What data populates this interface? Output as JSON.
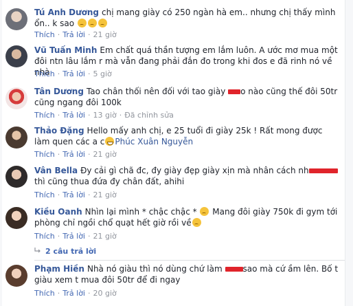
{
  "comments": [
    {
      "name": "Tú Anh Dương",
      "pre": "chị mang giày có 250 ngàn hà em.. nhưng chị thấy mình ổn.. k sao",
      "post": "",
      "act1": "Thích",
      "act2": "Trả lời",
      "time": "21 giờ"
    },
    {
      "name": "Vũ Tuấn Minh",
      "pre": "Em chất quá thần tượng em lắm luôn. A ước mơ mua một đôi ntn lâu lắm r mà vẫn đang phải đắn đo trong khi đos e đã rinh nó về nhà",
      "post": "",
      "act1": "Thích",
      "act2": "Trả lời",
      "time": "5 giờ"
    },
    {
      "name": "Tân Dương",
      "pre": "Tao chân thối nên đối với tao giày ",
      "post": "o nào cũng thế đôi 50tr cũng ngang đôi 100k",
      "act1": "Thích",
      "act2": "Trả lời",
      "time": "13 giờ",
      "edited": "Đã chỉnh sửa"
    },
    {
      "name": "Thảo Đặng",
      "pre": "Hello mấy anh chị, e 25 tuổi đi giày 25k ! Rất mong được làm quen các a c",
      "post": "",
      "tag": "Phúc Xuân Nguyễn",
      "act1": "Thích",
      "act2": "Trả lời",
      "time": "21 giờ"
    },
    {
      "name": "Vân Bella",
      "pre": "Đy cải gì chã đc, đy giày đẹp giày xịn mà nhân cách nh",
      "post": "thì cũng thua đứa đy chân đất, ahihi",
      "act1": "Thích",
      "act2": "Trả lời",
      "time": "21 giờ"
    },
    {
      "name": "Kiều Oanh",
      "pre": "Nhìn lại mình * chậc chậc * ",
      "post": "Mang đôi giày 750k đi gym tới phòng chỉ ngồi chổ quạt hết giờ rồi về",
      "act1": "Thích",
      "act2": "Trả lời",
      "time": "21 giờ",
      "replies": "2 câu trả lời"
    },
    {
      "name": "Phạm Hiền",
      "pre": "Nhà nó giàu thì nó dùng chứ làm ",
      "post": "sao mà cứ ầm lên. Bố t giàu xem t mua đôi 50tr để đi ngay",
      "act1": "Thích",
      "act2": "Trả lời",
      "time": "20 giờ"
    }
  ],
  "colors": {
    "name": "#365899",
    "link": "#4267b2",
    "meta": "#90949c",
    "text": "#1d2129",
    "redact": "#e0242b"
  }
}
